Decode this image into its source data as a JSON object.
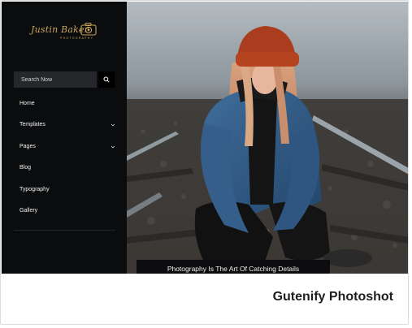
{
  "brand": {
    "logo_text": "Justin Baker",
    "logo_subtitle": "PHOTOGRAPHY"
  },
  "search": {
    "placeholder": "Search Now"
  },
  "menu": {
    "items": [
      {
        "label": "Home",
        "has_submenu": false
      },
      {
        "label": "Templates",
        "has_submenu": true
      },
      {
        "label": "Pages",
        "has_submenu": true
      },
      {
        "label": "Blog",
        "has_submenu": false
      },
      {
        "label": "Typography",
        "has_submenu": false
      },
      {
        "label": "Gallery",
        "has_submenu": false
      }
    ]
  },
  "hero": {
    "caption": "Photography Is The Art Of Catching Details"
  },
  "card": {
    "title": "Gutenify Photoshot"
  },
  "colors": {
    "sidebar_bg": "#0b0c0e",
    "accent_gold": "#c9a35c",
    "search_bg": "#25272b",
    "title_text": "#1e1e1e"
  },
  "icons": [
    "camera-icon",
    "search-icon",
    "chevron-down-icon"
  ]
}
